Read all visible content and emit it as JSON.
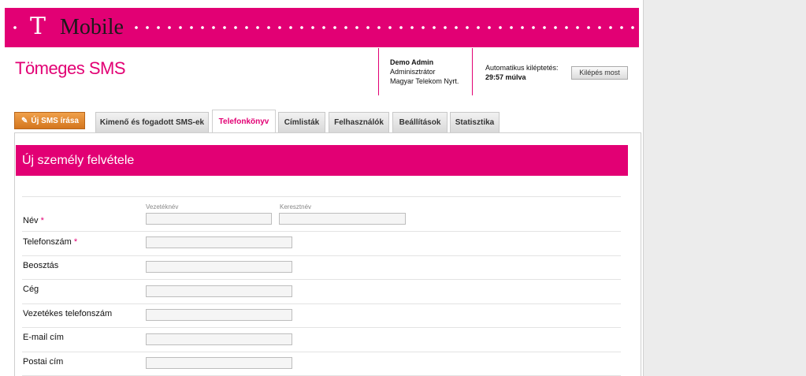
{
  "brand": {
    "logo_t": "T",
    "logo_name": "Mobile",
    "color": "#e20074"
  },
  "app_title": "Tömeges SMS",
  "user": {
    "name": "Demo Admin",
    "role": "Adminisztrátor",
    "company": "Magyar Telekom Nyrt."
  },
  "session": {
    "label": "Automatikus kiléptetés:",
    "remaining": "29:57 múlva",
    "logout_label": "Kilépés most"
  },
  "tabs": {
    "new_sms": "Új SMS írása",
    "items": [
      "Kimenő és fogadott SMS-ek",
      "Telefonkönyv",
      "Címlisták",
      "Felhasználók",
      "Beállítások",
      "Statisztika"
    ],
    "active": "Telefonkönyv"
  },
  "form": {
    "title": "Új személy felvétele",
    "fields": [
      {
        "label": "Név",
        "required": true,
        "sub_first": "Vezetéknév",
        "sub_second": "Keresztnév"
      },
      {
        "label": "Telefonszám",
        "required": true
      },
      {
        "label": "Beosztás"
      },
      {
        "label": "Cég"
      },
      {
        "label": "Vezetékes telefonszám"
      },
      {
        "label": "E-mail cím"
      },
      {
        "label": "Postai cím"
      }
    ],
    "required_mark": "*"
  }
}
